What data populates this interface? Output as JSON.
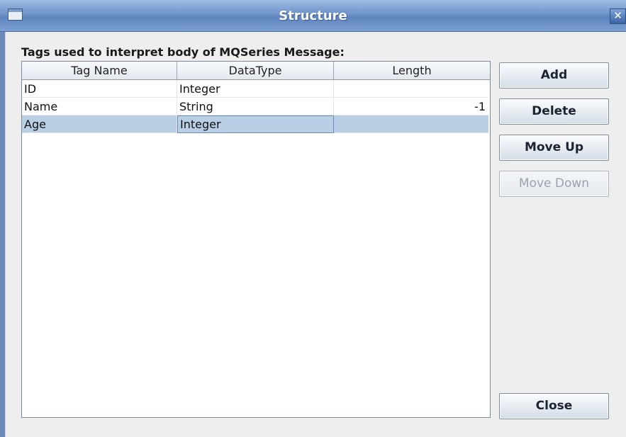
{
  "window": {
    "title": "Structure",
    "close_glyph": "✕",
    "system_icon": "window-menu-icon"
  },
  "header_label": "Tags used to interpret body of MQSeries Message:",
  "table": {
    "columns": [
      "Tag Name",
      "DataType",
      "Length"
    ],
    "rows": [
      {
        "tag": "ID",
        "type": "Integer",
        "length": ""
      },
      {
        "tag": "Name",
        "type": "String",
        "length": "-1"
      },
      {
        "tag": "Age",
        "type": "Integer",
        "length": "",
        "selected": true
      }
    ]
  },
  "buttons": {
    "add": "Add",
    "delete": "Delete",
    "move_up": "Move Up",
    "move_down": "Move Down",
    "close": "Close"
  },
  "states": {
    "move_down_enabled": false
  },
  "colors": {
    "titlebar": "#6f93c9",
    "selection": "#b8cfe5",
    "background": "#eeeeee"
  }
}
